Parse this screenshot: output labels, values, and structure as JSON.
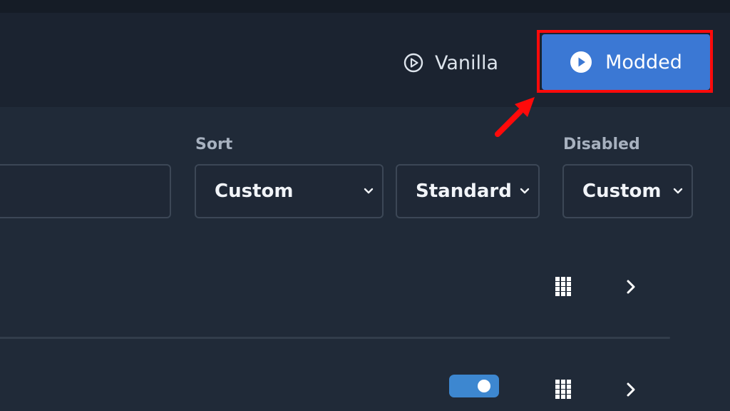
{
  "header": {
    "vanilla_label": "Vanilla",
    "modded_label": "Modded",
    "vanilla_icon": "play-outline-icon",
    "modded_icon": "play-filled-icon"
  },
  "filters": {
    "sort_label": "Sort",
    "disabled_label": "Disabled",
    "sort_value": "Custom",
    "type_value": "Standard",
    "disabled_value": "Custom",
    "search_value": ""
  },
  "rows": [
    {
      "toggle": null,
      "grid_icon": "grid-icon",
      "expand_icon": "chevron-right-icon"
    },
    {
      "toggle": "on",
      "grid_icon": "grid-icon",
      "expand_icon": "chevron-right-icon"
    }
  ],
  "colors": {
    "accent": "#3b78d4",
    "highlight": "#ff0a0a",
    "background": "#202a38",
    "toggle_on": "#3d87d0"
  }
}
